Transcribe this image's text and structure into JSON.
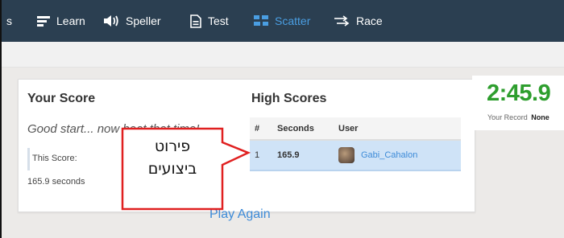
{
  "nav": {
    "partial_label": "s",
    "items": [
      {
        "label": "Learn",
        "icon": "learn-icon"
      },
      {
        "label": "Speller",
        "icon": "speaker-icon"
      },
      {
        "label": "Test",
        "icon": "test-icon"
      },
      {
        "label": "Scatter",
        "icon": "scatter-icon",
        "active": true
      },
      {
        "label": "Race",
        "icon": "race-icon"
      }
    ]
  },
  "your_score": {
    "title": "Your Score",
    "message": "Good start... now beat that time!",
    "this_score_label": "This Score:",
    "value_text": "165.9 seconds"
  },
  "high_scores": {
    "title": "High Scores",
    "columns": [
      "#",
      "Seconds",
      "User"
    ],
    "rows": [
      {
        "rank": "1",
        "seconds": "165.9",
        "user": "Gabi_Cahalon"
      }
    ]
  },
  "play_again_label": "Play Again",
  "record": {
    "time": "2:45.9",
    "label": "Your Record",
    "value": "None"
  },
  "callout": {
    "line1": "פירוט",
    "line2": "ביצועים"
  },
  "colors": {
    "nav_bg": "#2b3f51",
    "accent": "#4a9ee2",
    "record_green": "#2e9e2e",
    "callout_red": "#e02020"
  }
}
